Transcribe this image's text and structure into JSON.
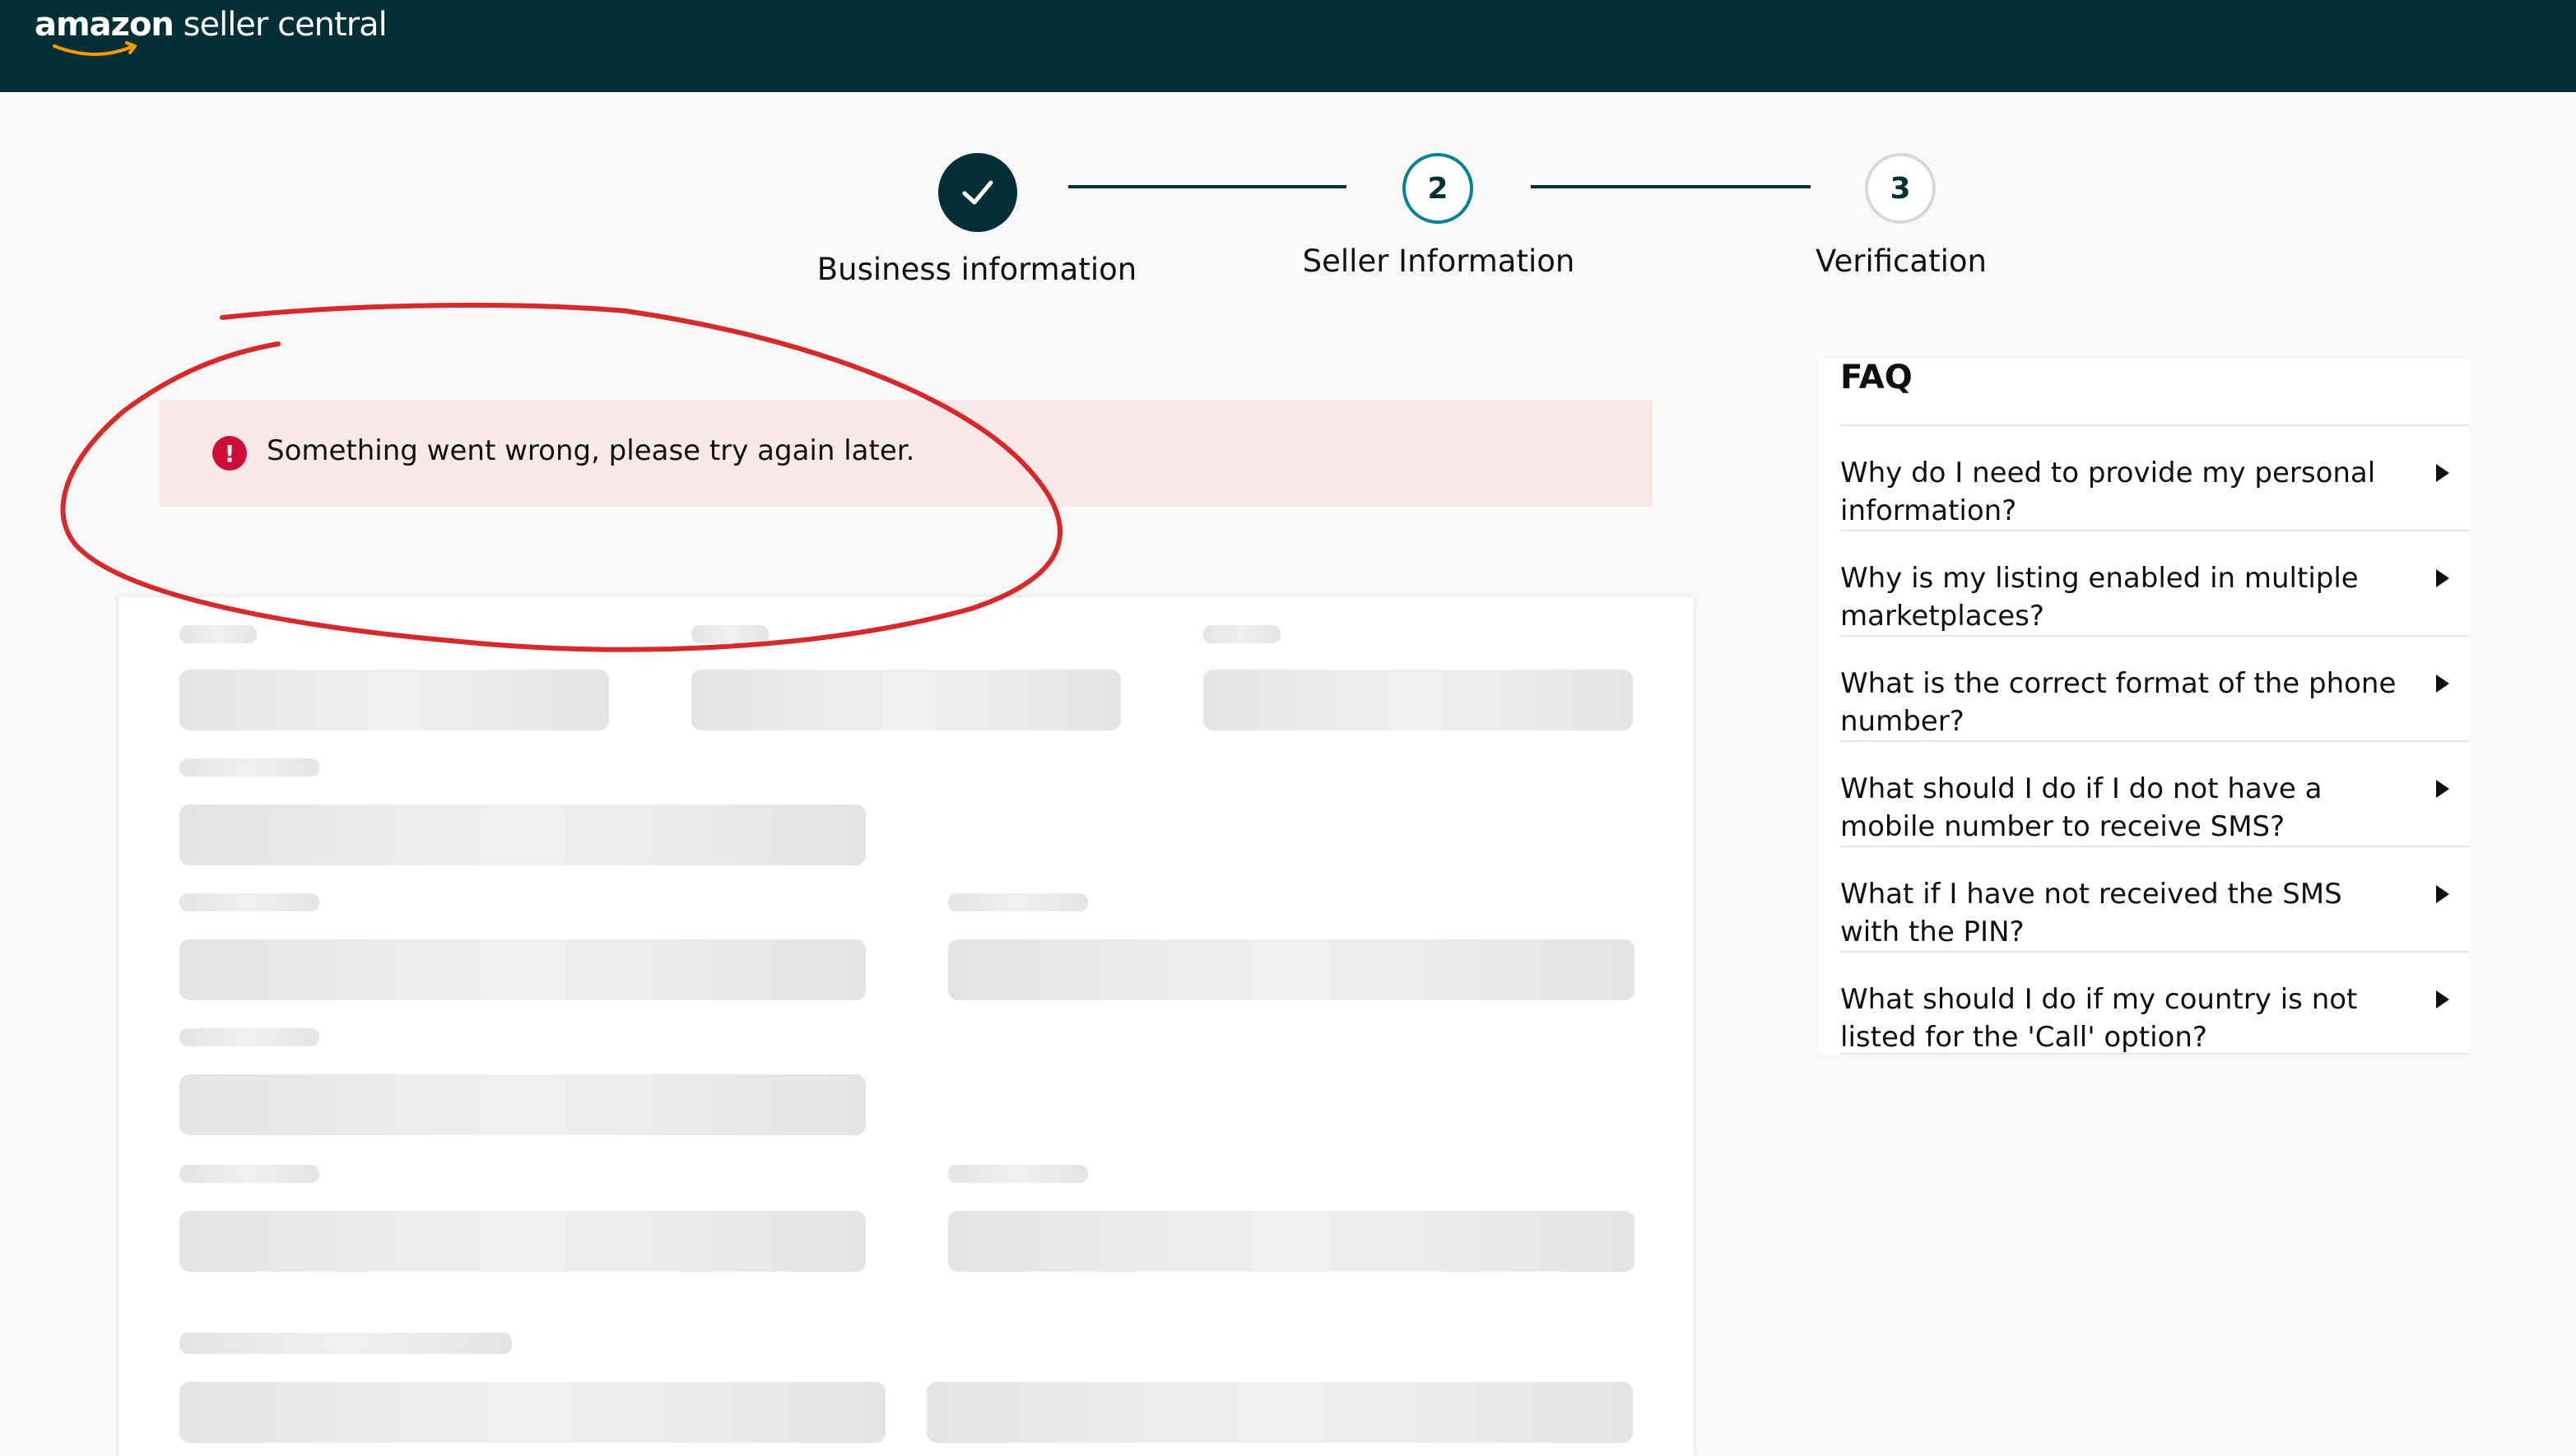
{
  "header": {
    "logo_amazon": "amazon",
    "logo_suffix": "seller central",
    "bg_color": "#002f36"
  },
  "stepper": {
    "steps": [
      {
        "label": "Business information",
        "state": "complete",
        "icon": "checkmark-icon"
      },
      {
        "label": "Seller Information",
        "number": "2",
        "state": "active"
      },
      {
        "label": "Verification",
        "number": "3",
        "state": "upcoming"
      }
    ],
    "accent_color": "#008296"
  },
  "error": {
    "message": "Something went wrong, please try again later.",
    "icon": "exclamation",
    "icon_symbol": "!",
    "color": "#cc0c39"
  },
  "faq": {
    "title": "FAQ",
    "items": [
      {
        "question": "Why do I need to provide my personal information?"
      },
      {
        "question": "Why is my listing enabled in multiple marketplaces?"
      },
      {
        "question": "What is the correct format of the phone number?"
      },
      {
        "question": "What should I do if I do not have a mobile number to receive SMS?"
      },
      {
        "question": "What if I have not received the SMS with the PIN?"
      },
      {
        "question": "What should I do if my country is not listed for the 'Call' option?"
      }
    ]
  },
  "annotation": {
    "color": "#d62a2a"
  }
}
